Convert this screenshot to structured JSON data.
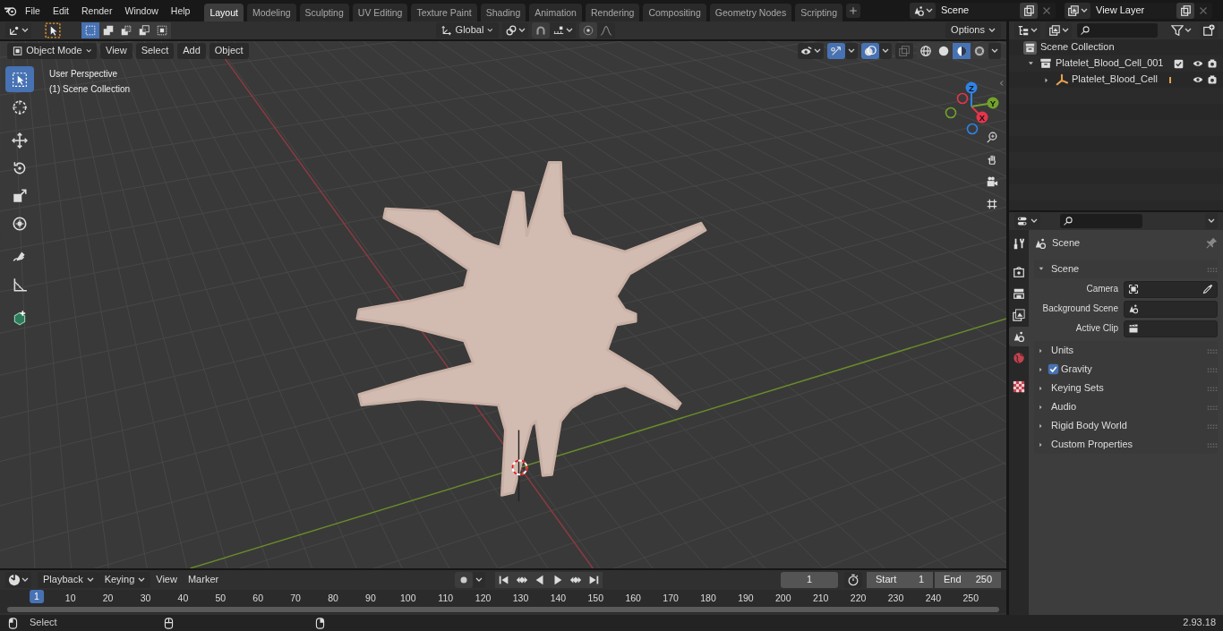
{
  "menu": [
    "File",
    "Edit",
    "Render",
    "Window",
    "Help"
  ],
  "workspaces": [
    {
      "label": "Layout",
      "selected": true
    },
    {
      "label": "Modeling",
      "selected": false
    },
    {
      "label": "Sculpting",
      "selected": false
    },
    {
      "label": "UV Editing",
      "selected": false
    },
    {
      "label": "Texture Paint",
      "selected": false
    },
    {
      "label": "Shading",
      "selected": false
    },
    {
      "label": "Animation",
      "selected": false
    },
    {
      "label": "Rendering",
      "selected": false
    },
    {
      "label": "Compositing",
      "selected": false
    },
    {
      "label": "Geometry Nodes",
      "selected": false
    },
    {
      "label": "Scripting",
      "selected": false
    }
  ],
  "scene_selector": {
    "value": "Scene"
  },
  "view_layer_selector": {
    "value": "View Layer"
  },
  "tool_header": {
    "select_modes": [
      {
        "kind": "set",
        "selected": true
      },
      {
        "kind": "extend",
        "selected": false
      },
      {
        "kind": "subtract",
        "selected": false
      },
      {
        "kind": "invert",
        "selected": false
      },
      {
        "kind": "intersect",
        "selected": false
      }
    ],
    "orientation": "Global",
    "options": "Options"
  },
  "viewport": {
    "mode": "Object Mode",
    "menus": [
      "View",
      "Select",
      "Add",
      "Object"
    ],
    "shading": [
      {
        "kind": "wireframe",
        "selected": false
      },
      {
        "kind": "solid",
        "selected": false
      },
      {
        "kind": "material",
        "selected": true
      },
      {
        "kind": "rendered",
        "selected": false
      }
    ],
    "overlay_text": [
      "User Perspective",
      "(1) Scene Collection"
    ],
    "tools": [
      {
        "kind": "select",
        "selected": true
      },
      {
        "kind": "cursor",
        "selected": false
      },
      {
        "kind": "move",
        "selected": false
      },
      {
        "kind": "rotate",
        "selected": false
      },
      {
        "kind": "scale",
        "selected": false
      },
      {
        "kind": "transform",
        "selected": false
      },
      {
        "kind": "annotate",
        "selected": false
      },
      {
        "kind": "measure",
        "selected": false
      },
      {
        "kind": "add_cube",
        "selected": false
      }
    ],
    "gizmo_axes": [
      {
        "label": "X",
        "color": "#e5354c"
      },
      {
        "label": "Y",
        "color": "#72a22b"
      },
      {
        "label": "Z",
        "color": "#2f83e6"
      }
    ]
  },
  "outliner": {
    "root": "Scene Collection",
    "items": [
      {
        "label": "Platelet_Blood_Cell_001",
        "kind": "collection",
        "expanded": true,
        "checked": true,
        "children": [
          {
            "label": "Platelet_Blood_Cell",
            "kind": "object",
            "expanded": false
          }
        ]
      }
    ]
  },
  "properties": {
    "tabs": [
      {
        "kind": "tool",
        "selected": false
      },
      {
        "kind": "render",
        "selected": false
      },
      {
        "kind": "output",
        "selected": false
      },
      {
        "kind": "view_layer",
        "selected": false
      },
      {
        "kind": "scene",
        "selected": true
      },
      {
        "kind": "world",
        "selected": false
      },
      {
        "kind": "texture",
        "selected": false
      }
    ],
    "context": "Scene",
    "panels": [
      {
        "label": "Scene",
        "kind": "plain",
        "expanded": true,
        "fields": [
          {
            "label": "Camera",
            "kind": "camera"
          },
          {
            "label": "Background Scene",
            "kind": "scene"
          },
          {
            "label": "Active Clip",
            "kind": "clip"
          }
        ]
      },
      {
        "label": "Units",
        "kind": "plain",
        "expanded": false
      },
      {
        "label": "Gravity",
        "kind": "checkbox",
        "expanded": false,
        "checked": true
      },
      {
        "label": "Keying Sets",
        "kind": "plain",
        "expanded": false
      },
      {
        "label": "Audio",
        "kind": "plain",
        "expanded": false
      },
      {
        "label": "Rigid Body World",
        "kind": "plain",
        "expanded": false
      },
      {
        "label": "Custom Properties",
        "kind": "plain",
        "expanded": false
      }
    ]
  },
  "timeline": {
    "menus": [
      "Playback",
      "Keying",
      "View",
      "Marker"
    ],
    "current_frame": "1",
    "start_label": "Start",
    "start": "1",
    "end_label": "End",
    "end": "250",
    "playhead": "1",
    "ruler": [
      "10",
      "20",
      "30",
      "40",
      "50",
      "60",
      "70",
      "80",
      "90",
      "100",
      "110",
      "120",
      "130",
      "140",
      "150",
      "160",
      "170",
      "180",
      "190",
      "200",
      "210",
      "220",
      "230",
      "240",
      "250"
    ]
  },
  "status_bar": {
    "hint": "Select",
    "version": "2.93.18"
  }
}
